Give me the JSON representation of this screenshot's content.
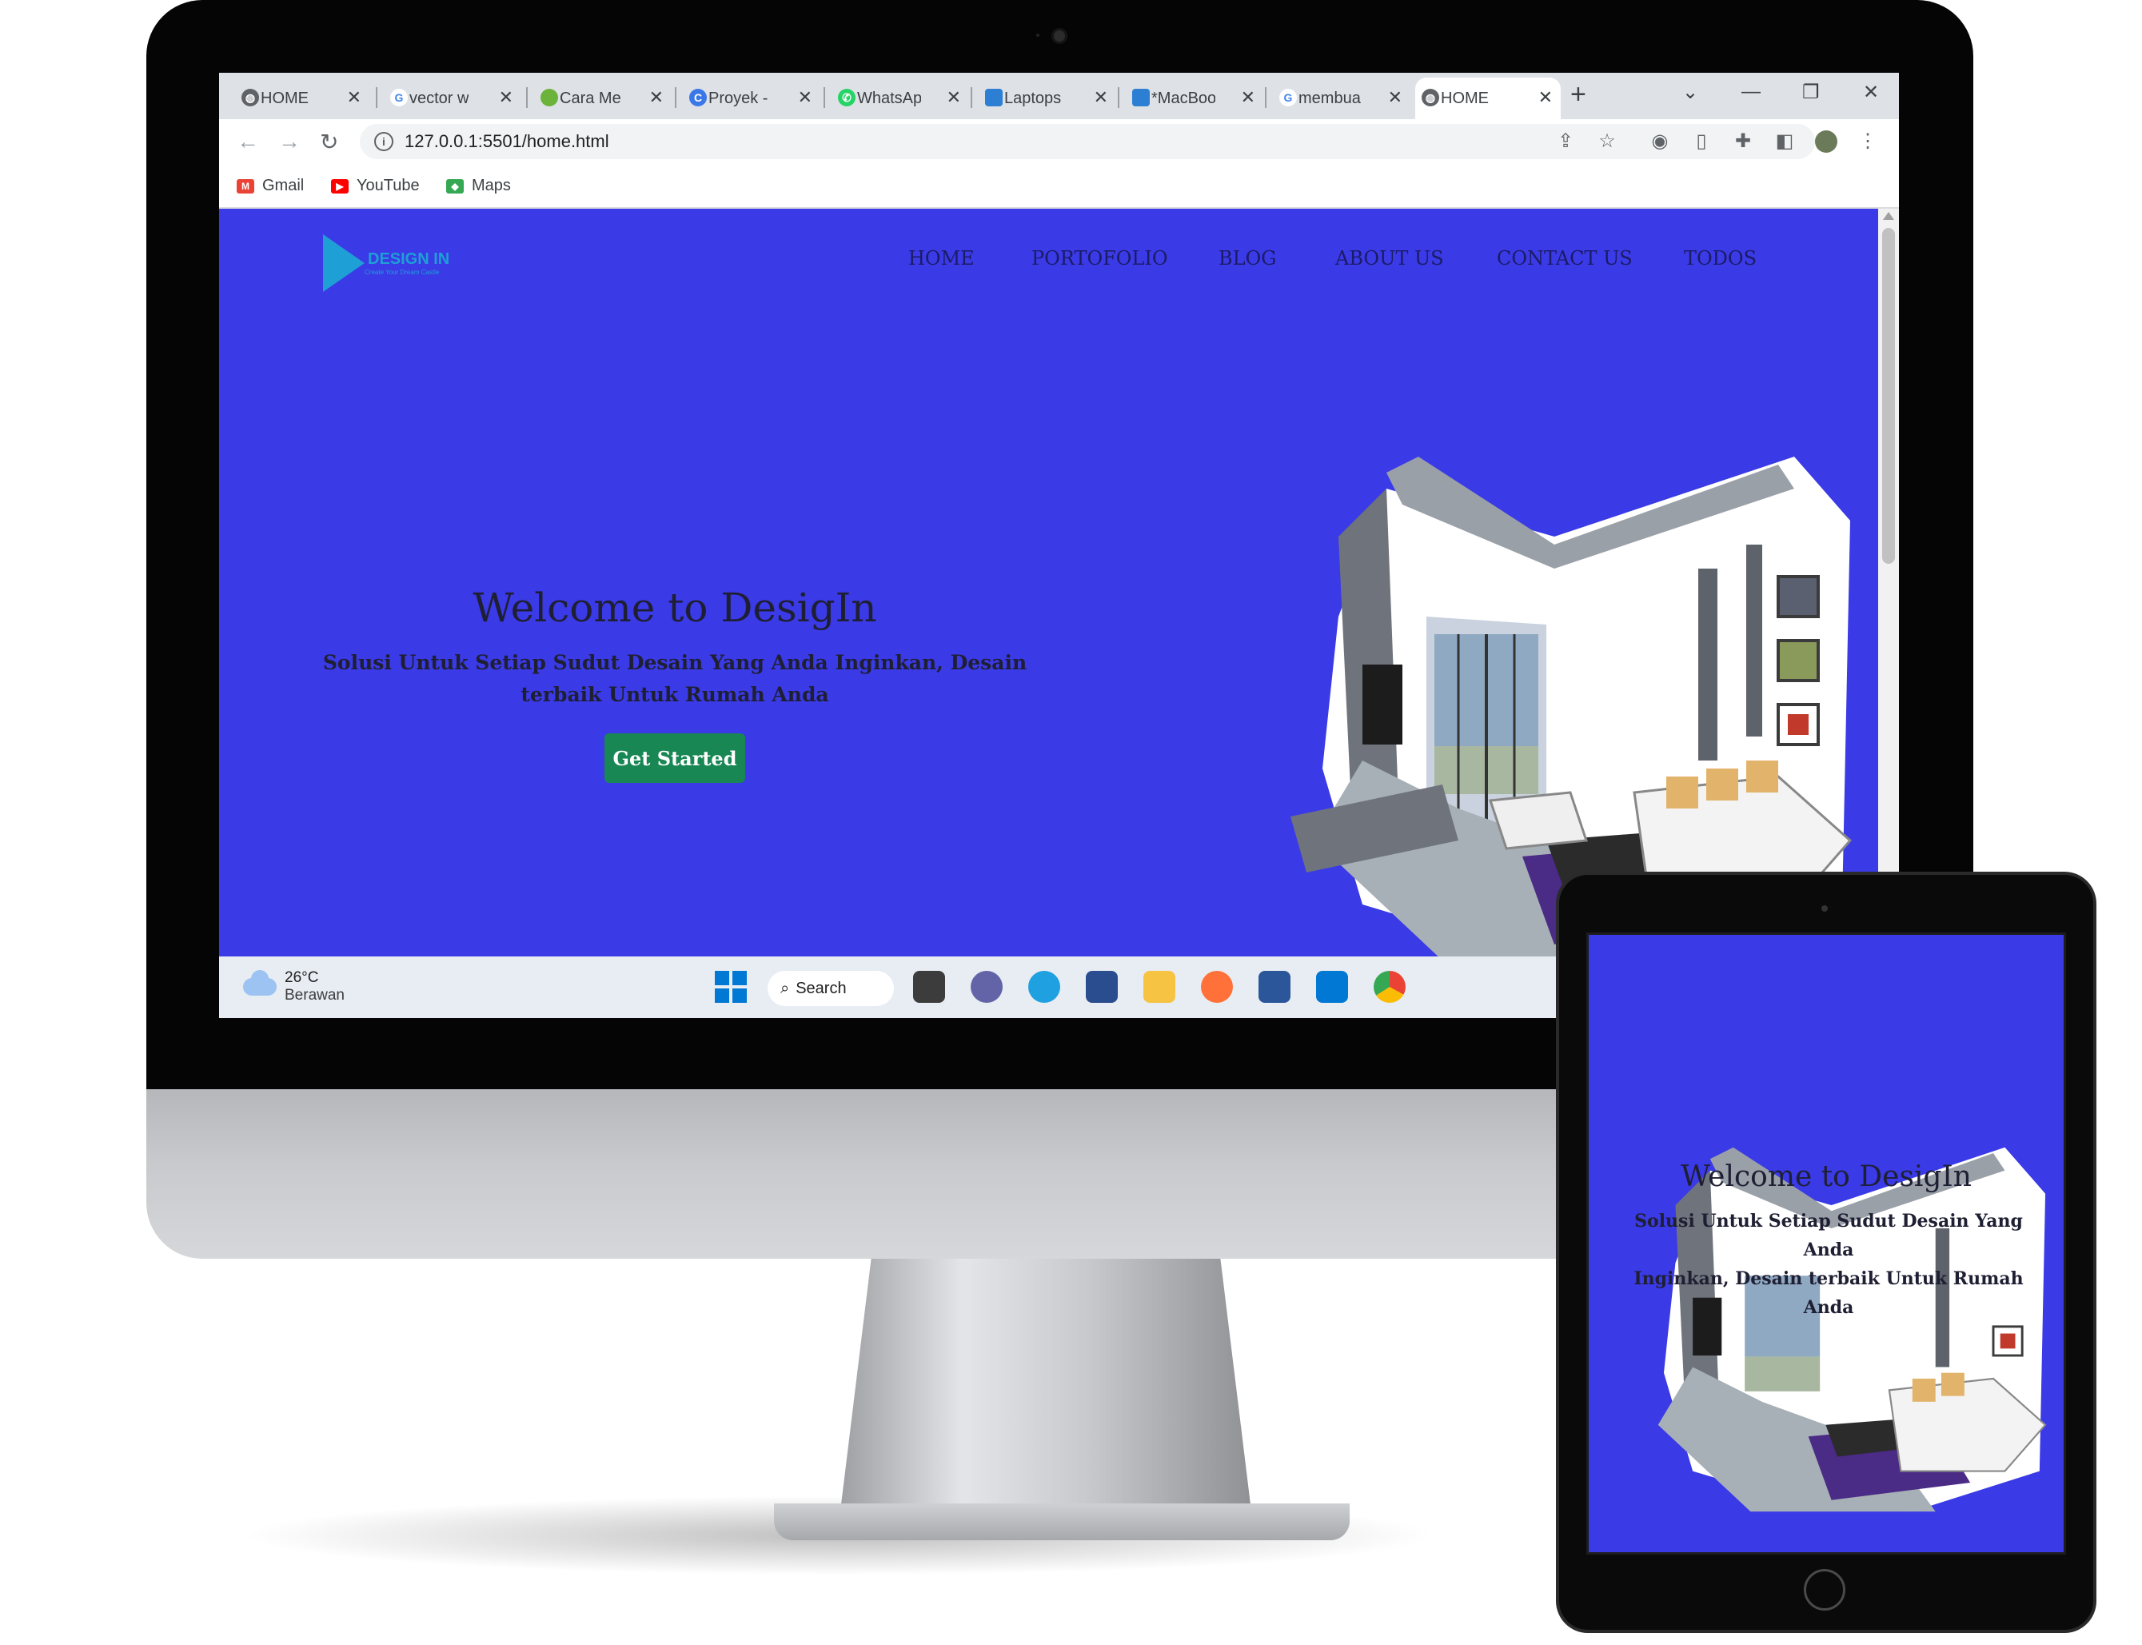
{
  "browser": {
    "tabs": [
      {
        "label": "HOME",
        "favicon": "globe-icon",
        "active": false
      },
      {
        "label": "vector w",
        "favicon": "google-icon",
        "active": false
      },
      {
        "label": "Cara Me",
        "favicon": "leaf-icon",
        "active": false
      },
      {
        "label": "Proyek -",
        "favicon": "c-circle-icon",
        "active": false
      },
      {
        "label": "WhatsAp",
        "favicon": "whatsapp-icon",
        "active": false
      },
      {
        "label": "Laptops",
        "favicon": "stack-icon",
        "active": false
      },
      {
        "label": "*MacBoo",
        "favicon": "stack-icon",
        "active": false
      },
      {
        "label": "membua",
        "favicon": "google-icon",
        "active": false
      },
      {
        "label": "HOME",
        "favicon": "globe-icon",
        "active": true
      }
    ],
    "close_glyph": "✕",
    "new_tab_glyph": "+",
    "url": "127.0.0.1:5501/home.html",
    "bookmarks": [
      {
        "label": "Gmail",
        "icon": "gmail-icon"
      },
      {
        "label": "YouTube",
        "icon": "youtube-icon"
      },
      {
        "label": "Maps",
        "icon": "maps-icon"
      }
    ]
  },
  "site": {
    "logo_text": "DESIGN IN",
    "logo_tagline": "Create Your Dream Castle",
    "nav": [
      "HOME",
      "PORTOFOLIO",
      "BLOG",
      "ABOUT US",
      "CONTACT US",
      "TODOS"
    ],
    "hero_title": "Welcome to DesigIn",
    "hero_subtitle": "Solusi Untuk Setiap Sudut Desain Yang Anda Inginkan, Desain terbaik Untuk Rumah Anda",
    "cta_label": "Get Started",
    "bg_color": "#3a3ae6",
    "cta_color": "#198754"
  },
  "taskbar": {
    "weather_temp": "26°C",
    "weather_desc": "Berawan",
    "search_label": "Search"
  },
  "ipad": {
    "hero_title": "Welcome to DesigIn",
    "hero_subtitle_line1": "Solusi Untuk Setiap Sudut Desain Yang Anda",
    "hero_subtitle_line2": "Inginkan, Desain terbaik Untuk Rumah Anda"
  }
}
